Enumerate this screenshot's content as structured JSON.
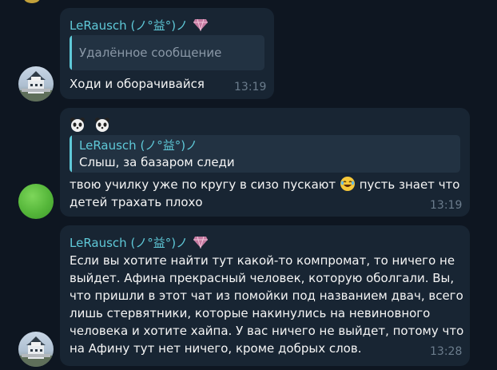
{
  "messages": [
    {
      "sender": "LeRausch (ノ°益°)ノ",
      "reply_text": "Удалённое сообщение",
      "lines": [
        "Ходи и оборачивайся"
      ],
      "time": "13:19"
    },
    {
      "header_emoji": "🐼 🐼",
      "reply_sender": "LeRausch (ノ°益°)ノ",
      "reply_text": "Слыш, за базаром следи",
      "line1_a": "твою училку уже по кругу в сизо пускают",
      "line1_b": "пусть знает что",
      "line2": "детей трахать плохо",
      "time": "13:19"
    },
    {
      "sender": "LeRausch (ノ°益°)ノ",
      "lines": [
        "Если вы хотите найти тут какой-то компромат, то ничего не",
        "выйдет. Афина прекрасный человек, которую оболгали. Вы,",
        "что пришли в этот чат из помойки под названием двач, всего",
        "лишь стервятники, которые накинулись на невиновного",
        "человека и хотите хайпа. У вас ничего не выйдет, потому что",
        "на Афину тут нет ничего, кроме добрых слов."
      ],
      "time": "13:28"
    }
  ],
  "colors": {
    "background": "#0e1621",
    "bubble": "#182533",
    "accent": "#5fc9d8",
    "reply_bg": "#223242",
    "time": "#6b7c8c"
  },
  "icons": [
    "gem-icon",
    "panda-emoji",
    "laughing-emoji",
    "avatar-castle",
    "avatar-green"
  ]
}
